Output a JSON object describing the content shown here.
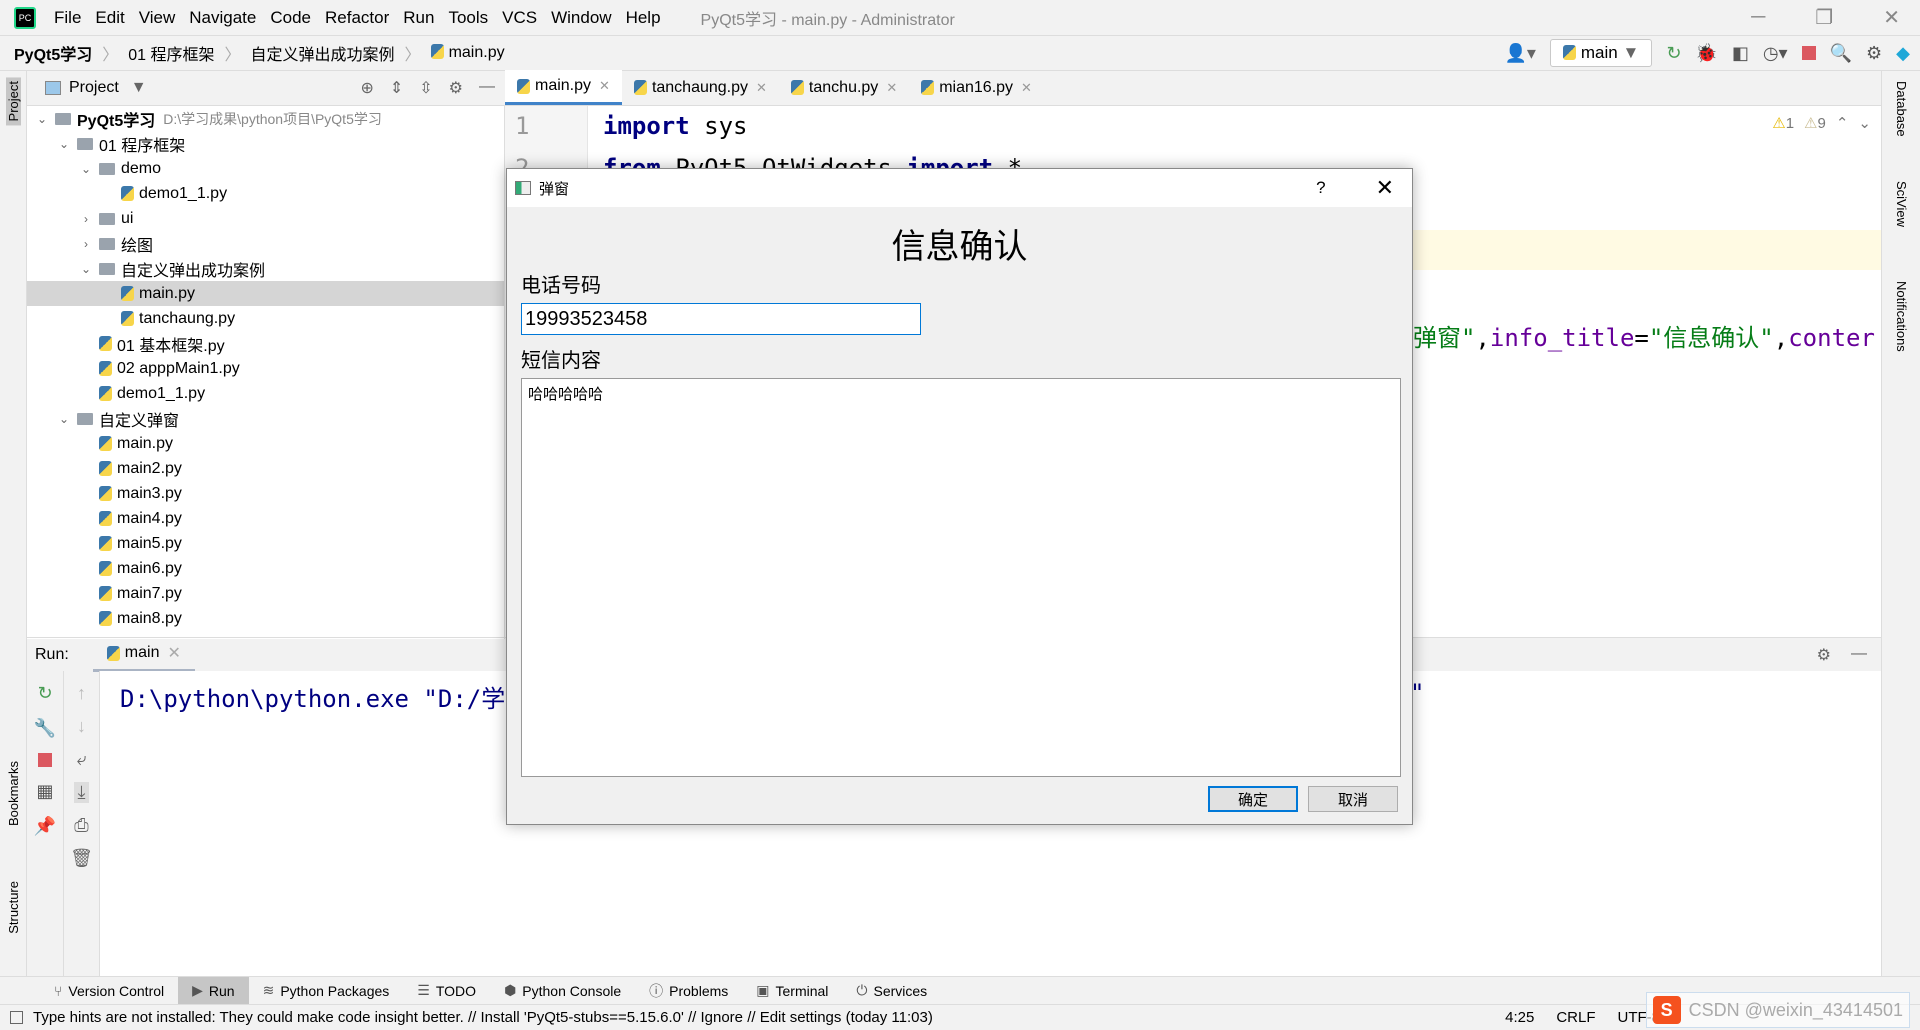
{
  "menubar": {
    "items": [
      "File",
      "Edit",
      "View",
      "Navigate",
      "Code",
      "Refactor",
      "Run",
      "Tools",
      "VCS",
      "Window",
      "Help"
    ],
    "title": "PyQt5学习 - main.py - Administrator"
  },
  "breadcrumb": [
    "PyQt5学习",
    "01 程序框架",
    "自定义弹出成功案例",
    "main.py"
  ],
  "toolbar": {
    "run_config": "main"
  },
  "project": {
    "header": "Project",
    "root": "PyQt5学习",
    "root_path": "D:\\学习成果\\python项目\\PyQt5学习",
    "tree": [
      {
        "label": "01 程序框架",
        "level": 1,
        "type": "folder",
        "open": true
      },
      {
        "label": "demo",
        "level": 2,
        "type": "folder",
        "open": true
      },
      {
        "label": "demo1_1.py",
        "level": 3,
        "type": "file"
      },
      {
        "label": "ui",
        "level": 2,
        "type": "folder",
        "open": false
      },
      {
        "label": "绘图",
        "level": 2,
        "type": "folder",
        "open": false
      },
      {
        "label": "自定义弹出成功案例",
        "level": 2,
        "type": "folder",
        "open": true
      },
      {
        "label": "main.py",
        "level": 3,
        "type": "file",
        "selected": true
      },
      {
        "label": "tanchaung.py",
        "level": 3,
        "type": "file"
      },
      {
        "label": "01 基本框架.py",
        "level": 2,
        "type": "file"
      },
      {
        "label": "02 apppMain1.py",
        "level": 2,
        "type": "file"
      },
      {
        "label": "demo1_1.py",
        "level": 2,
        "type": "file"
      },
      {
        "label": "自定义弹窗",
        "level": 1,
        "type": "folder",
        "open": true
      },
      {
        "label": "main.py",
        "level": 2,
        "type": "file"
      },
      {
        "label": "main2.py",
        "level": 2,
        "type": "file"
      },
      {
        "label": "main3.py",
        "level": 2,
        "type": "file"
      },
      {
        "label": "main4.py",
        "level": 2,
        "type": "file"
      },
      {
        "label": "main5.py",
        "level": 2,
        "type": "file"
      },
      {
        "label": "main6.py",
        "level": 2,
        "type": "file"
      },
      {
        "label": "main7.py",
        "level": 2,
        "type": "file"
      },
      {
        "label": "main8.py",
        "level": 2,
        "type": "file"
      }
    ]
  },
  "editor": {
    "tabs": [
      "main.py",
      "tanchaung.py",
      "tanchu.py",
      "mian16.py"
    ],
    "line_numbers": [
      "1",
      "2"
    ],
    "code": {
      "l1_kw": "import",
      "l1_rest": " sys",
      "l2_kw1": "from",
      "l2_mid": " PyQt5.QtWidgets ",
      "l2_kw2": "import",
      "l2_end": " *",
      "frag_str1": "弹窗\"",
      "frag_comma": ",",
      "frag_param": "info_title",
      "frag_eq": "=",
      "frag_str2": "\"信息确认\"",
      "frag_comma2": ",",
      "frag_param2": "conter"
    },
    "warnings": "1",
    "weak_warnings": "9"
  },
  "run": {
    "label": "Run:",
    "tab": "main",
    "output": "D:\\python\\python.exe \"D:/学",
    "output_tail": "\""
  },
  "right_stripe": [
    "Database",
    "SciView",
    "Notifications"
  ],
  "left_stripe": [
    "Project",
    "Bookmarks",
    "Structure"
  ],
  "bottom_tools": [
    "Version Control",
    "Run",
    "Python Packages",
    "TODO",
    "Python Console",
    "Problems",
    "Terminal",
    "Services"
  ],
  "status": {
    "message": "Type hints are not installed: They could make code insight better. // Install 'PyQt5-stubs==5.15.6.0' // Ignore // Edit settings (today 11:03)",
    "position": "4:25",
    "line_sep": "CRLF",
    "encoding": "UTF-8"
  },
  "watermark": "CSDN @weixin_43414501",
  "dialog": {
    "title": "弹窗",
    "help": "?",
    "heading": "信息确认",
    "phone_label": "电话号码",
    "phone_value": "19993523458",
    "sms_label": "短信内容",
    "sms_value": "哈哈哈哈哈",
    "ok": "确定",
    "cancel": "取消"
  }
}
